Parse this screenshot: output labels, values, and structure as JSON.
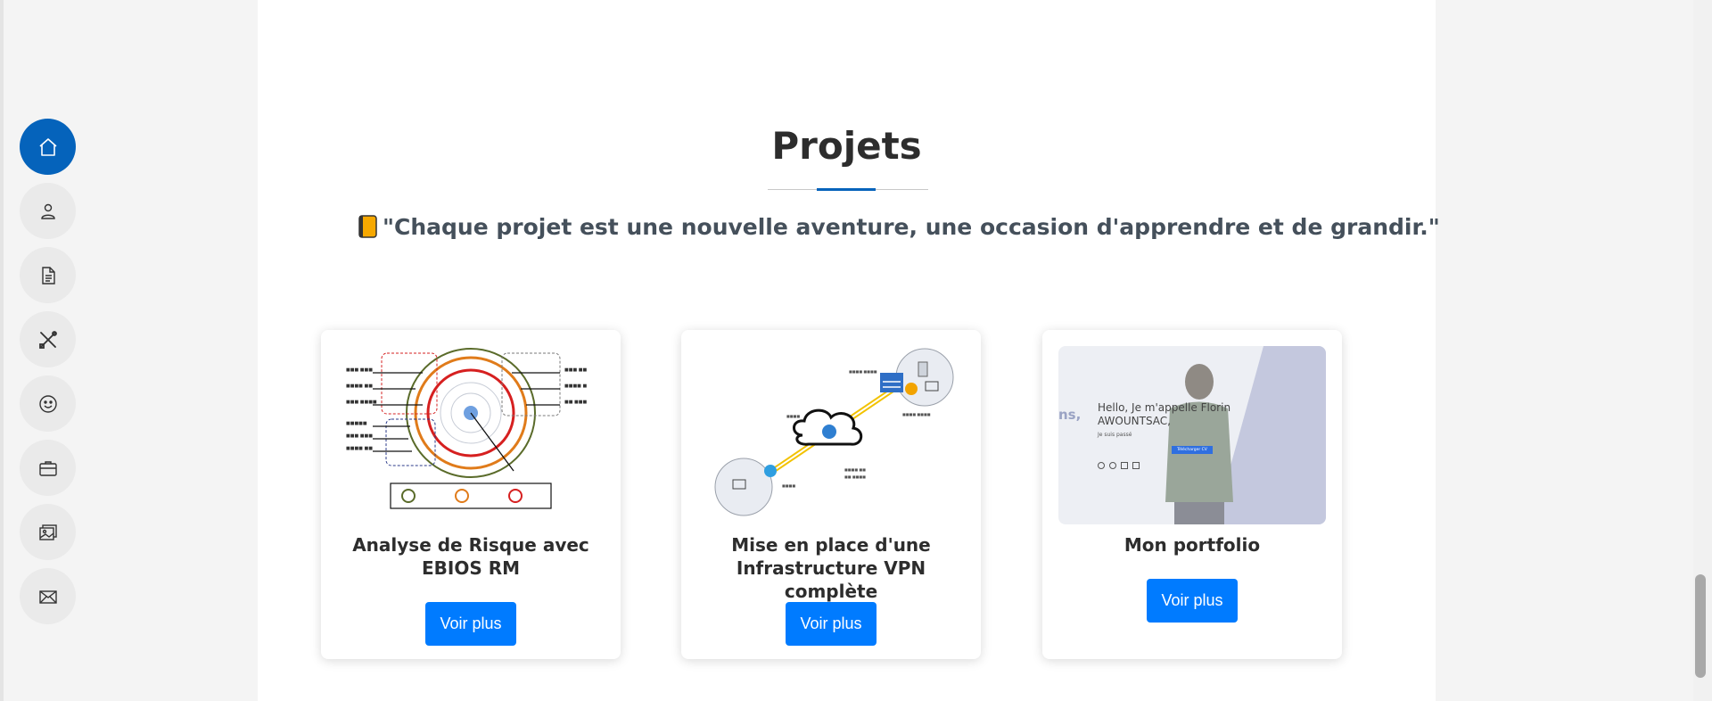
{
  "nav": {
    "items": [
      {
        "icon": "home-icon",
        "active": true
      },
      {
        "icon": "person-icon",
        "active": false
      },
      {
        "icon": "document-icon",
        "active": false
      },
      {
        "icon": "tools-icon",
        "active": false
      },
      {
        "icon": "smiley-icon",
        "active": false
      },
      {
        "icon": "briefcase-icon",
        "active": false
      },
      {
        "icon": "images-icon",
        "active": false
      },
      {
        "icon": "envelope-icon",
        "active": false
      }
    ]
  },
  "section": {
    "title": "Projets",
    "quote_icon": "notebook-icon",
    "quote": "\"Chaque projet est une nouvelle aventure, une occasion d'apprendre et de grandir.\""
  },
  "projects": [
    {
      "title": "Analyse de Risque avec EBIOS RM",
      "button": "Voir plus",
      "image": "ebios-diagram"
    },
    {
      "title": "Mise en place d'une Infrastructure VPN complète",
      "button": "Voir plus",
      "image": "vpn-diagram"
    },
    {
      "title": "Mon portfolio",
      "button": "Voir plus",
      "image": "portfolio-screenshot",
      "screenshot_text": {
        "greeting": "Hello, Je m'appelle Florin AWOUNTSAC,",
        "subtitle": "Je suis passé",
        "side_fragment": "ns,",
        "button": "Télécharger CV"
      }
    }
  ],
  "colors": {
    "accent": "#0563bb",
    "button": "#007bff",
    "title": "#2d2d2d",
    "quote": "#45505b"
  }
}
